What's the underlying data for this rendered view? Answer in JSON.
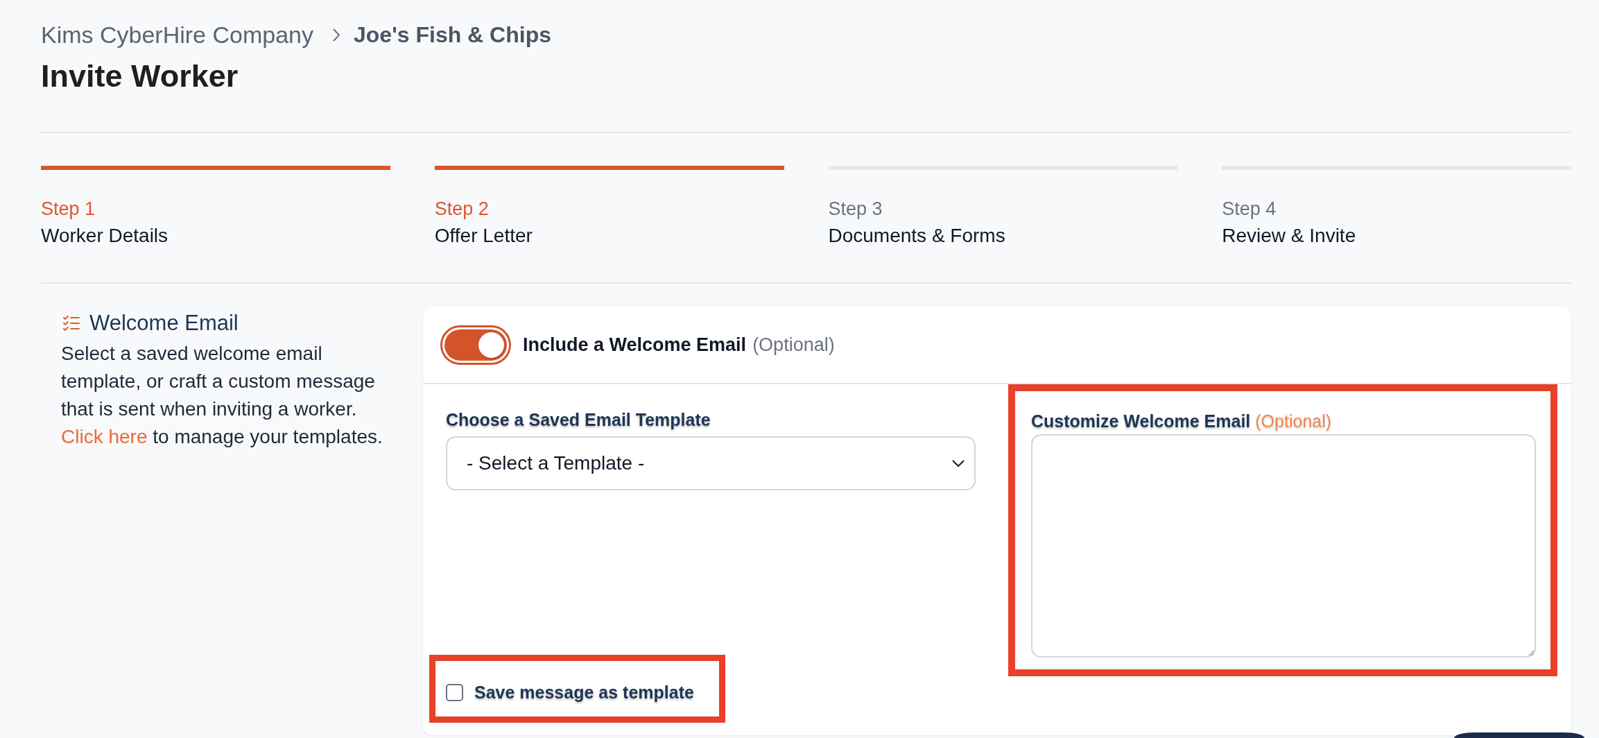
{
  "breadcrumb": [
    {
      "label": "Kims CyberHire Company",
      "current": false
    },
    {
      "label": "Joe's Fish & Chips",
      "current": true
    }
  ],
  "page_title": "Invite Worker",
  "steps": [
    {
      "step": "Step 1",
      "title": "Worker Details",
      "active": true
    },
    {
      "step": "Step 2",
      "title": "Offer Letter",
      "active": true
    },
    {
      "step": "Step 3",
      "title": "Documents & Forms",
      "active": false
    },
    {
      "step": "Step 4",
      "title": "Review & Invite",
      "active": false
    }
  ],
  "section": {
    "title": "Welcome Email",
    "description": "Select a saved welcome email template, or craft a custom message that is sent when inviting a worker.",
    "link": "Click here",
    "description_end": "to manage your templates."
  },
  "welcome_email": {
    "toggle": {
      "label": "Include a Welcome Email",
      "hint": "(Optional)",
      "on": true
    },
    "template_select": {
      "label": "Choose a Saved Email Template",
      "value": "- Select a Template -"
    },
    "custom_message": {
      "label": "Customize Welcome Email",
      "hint": "(Optional)",
      "highlighted": true
    },
    "save_template": {
      "label": "Save message as template",
      "checked": false,
      "highlighted": true
    }
  }
}
